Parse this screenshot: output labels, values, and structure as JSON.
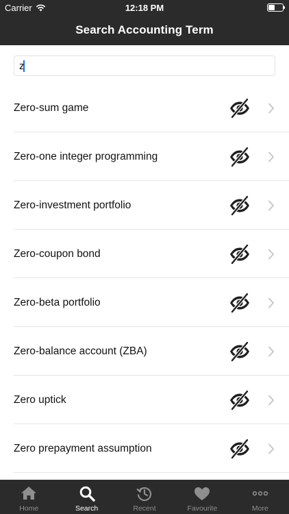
{
  "status_bar": {
    "carrier": "Carrier",
    "time": "12:18 PM"
  },
  "nav": {
    "title": "Search Accounting Term"
  },
  "search": {
    "value": "z"
  },
  "results": [
    {
      "label": "Zero-sum game"
    },
    {
      "label": "Zero-one integer programming"
    },
    {
      "label": "Zero-investment portfolio"
    },
    {
      "label": "Zero-coupon bond"
    },
    {
      "label": "Zero-beta portfolio"
    },
    {
      "label": "Zero-balance account (ZBA)"
    },
    {
      "label": "Zero uptick"
    },
    {
      "label": "Zero prepayment assumption"
    }
  ],
  "row_icons": {
    "visibility": "eye-slash-icon",
    "disclosure": "chevron-right-icon"
  },
  "tabs": [
    {
      "label": "Home",
      "icon": "home-icon",
      "active": false
    },
    {
      "label": "Search",
      "icon": "search-icon",
      "active": true
    },
    {
      "label": "Recent",
      "icon": "history-icon",
      "active": false
    },
    {
      "label": "Favourite",
      "icon": "heart-icon",
      "active": false
    },
    {
      "label": "More",
      "icon": "more-icon",
      "active": false
    }
  ],
  "colors": {
    "bar": "#2b2b2b",
    "tab_inactive": "#8e8e8e",
    "tab_active": "#ffffff",
    "caret": "#1a6cf0"
  }
}
